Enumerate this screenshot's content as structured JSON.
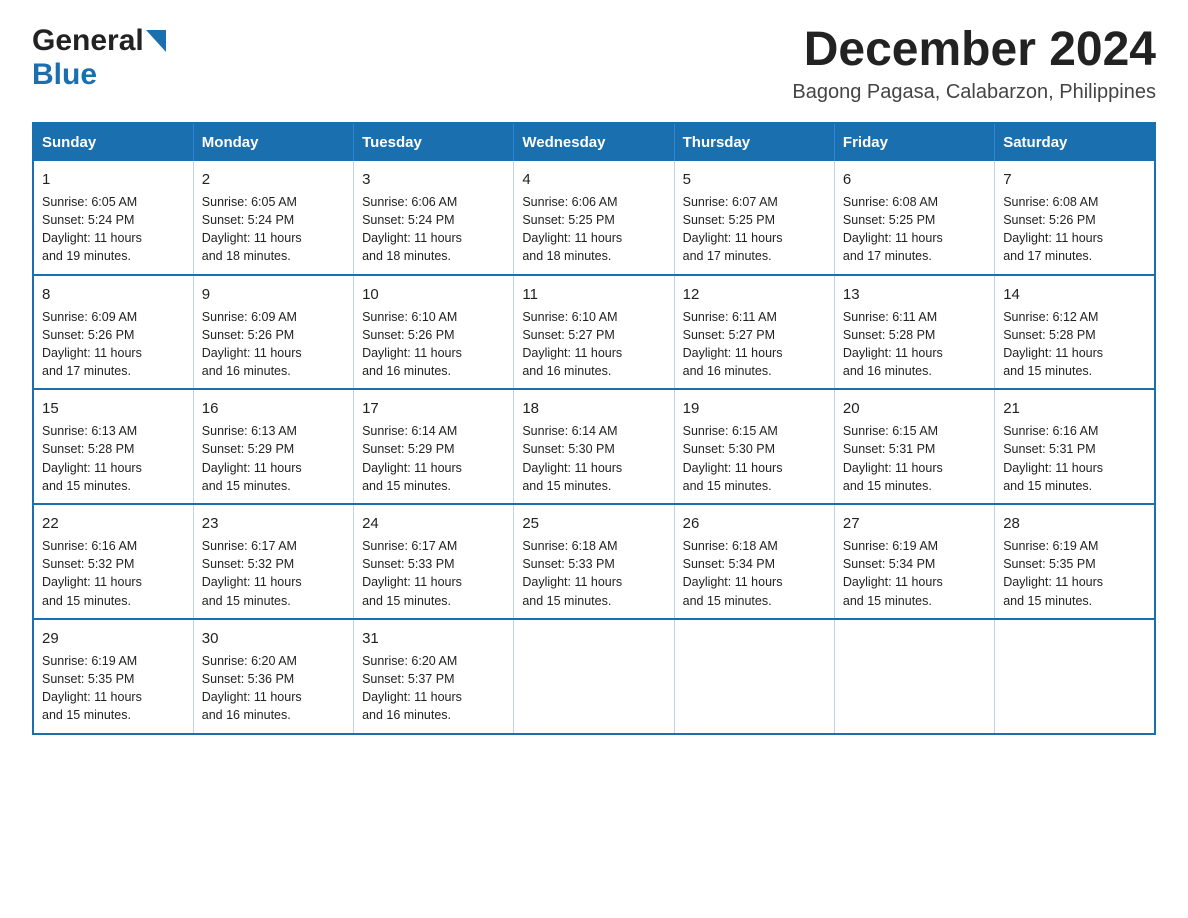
{
  "header": {
    "logo_general": "General",
    "logo_blue": "Blue",
    "month_year": "December 2024",
    "location": "Bagong Pagasa, Calabarzon, Philippines"
  },
  "calendar": {
    "days_of_week": [
      "Sunday",
      "Monday",
      "Tuesday",
      "Wednesday",
      "Thursday",
      "Friday",
      "Saturday"
    ],
    "weeks": [
      [
        {
          "day": "1",
          "sunrise": "6:05 AM",
          "sunset": "5:24 PM",
          "daylight": "11 hours and 19 minutes."
        },
        {
          "day": "2",
          "sunrise": "6:05 AM",
          "sunset": "5:24 PM",
          "daylight": "11 hours and 18 minutes."
        },
        {
          "day": "3",
          "sunrise": "6:06 AM",
          "sunset": "5:24 PM",
          "daylight": "11 hours and 18 minutes."
        },
        {
          "day": "4",
          "sunrise": "6:06 AM",
          "sunset": "5:25 PM",
          "daylight": "11 hours and 18 minutes."
        },
        {
          "day": "5",
          "sunrise": "6:07 AM",
          "sunset": "5:25 PM",
          "daylight": "11 hours and 17 minutes."
        },
        {
          "day": "6",
          "sunrise": "6:08 AM",
          "sunset": "5:25 PM",
          "daylight": "11 hours and 17 minutes."
        },
        {
          "day": "7",
          "sunrise": "6:08 AM",
          "sunset": "5:26 PM",
          "daylight": "11 hours and 17 minutes."
        }
      ],
      [
        {
          "day": "8",
          "sunrise": "6:09 AM",
          "sunset": "5:26 PM",
          "daylight": "11 hours and 17 minutes."
        },
        {
          "day": "9",
          "sunrise": "6:09 AM",
          "sunset": "5:26 PM",
          "daylight": "11 hours and 16 minutes."
        },
        {
          "day": "10",
          "sunrise": "6:10 AM",
          "sunset": "5:26 PM",
          "daylight": "11 hours and 16 minutes."
        },
        {
          "day": "11",
          "sunrise": "6:10 AM",
          "sunset": "5:27 PM",
          "daylight": "11 hours and 16 minutes."
        },
        {
          "day": "12",
          "sunrise": "6:11 AM",
          "sunset": "5:27 PM",
          "daylight": "11 hours and 16 minutes."
        },
        {
          "day": "13",
          "sunrise": "6:11 AM",
          "sunset": "5:28 PM",
          "daylight": "11 hours and 16 minutes."
        },
        {
          "day": "14",
          "sunrise": "6:12 AM",
          "sunset": "5:28 PM",
          "daylight": "11 hours and 15 minutes."
        }
      ],
      [
        {
          "day": "15",
          "sunrise": "6:13 AM",
          "sunset": "5:28 PM",
          "daylight": "11 hours and 15 minutes."
        },
        {
          "day": "16",
          "sunrise": "6:13 AM",
          "sunset": "5:29 PM",
          "daylight": "11 hours and 15 minutes."
        },
        {
          "day": "17",
          "sunrise": "6:14 AM",
          "sunset": "5:29 PM",
          "daylight": "11 hours and 15 minutes."
        },
        {
          "day": "18",
          "sunrise": "6:14 AM",
          "sunset": "5:30 PM",
          "daylight": "11 hours and 15 minutes."
        },
        {
          "day": "19",
          "sunrise": "6:15 AM",
          "sunset": "5:30 PM",
          "daylight": "11 hours and 15 minutes."
        },
        {
          "day": "20",
          "sunrise": "6:15 AM",
          "sunset": "5:31 PM",
          "daylight": "11 hours and 15 minutes."
        },
        {
          "day": "21",
          "sunrise": "6:16 AM",
          "sunset": "5:31 PM",
          "daylight": "11 hours and 15 minutes."
        }
      ],
      [
        {
          "day": "22",
          "sunrise": "6:16 AM",
          "sunset": "5:32 PM",
          "daylight": "11 hours and 15 minutes."
        },
        {
          "day": "23",
          "sunrise": "6:17 AM",
          "sunset": "5:32 PM",
          "daylight": "11 hours and 15 minutes."
        },
        {
          "day": "24",
          "sunrise": "6:17 AM",
          "sunset": "5:33 PM",
          "daylight": "11 hours and 15 minutes."
        },
        {
          "day": "25",
          "sunrise": "6:18 AM",
          "sunset": "5:33 PM",
          "daylight": "11 hours and 15 minutes."
        },
        {
          "day": "26",
          "sunrise": "6:18 AM",
          "sunset": "5:34 PM",
          "daylight": "11 hours and 15 minutes."
        },
        {
          "day": "27",
          "sunrise": "6:19 AM",
          "sunset": "5:34 PM",
          "daylight": "11 hours and 15 minutes."
        },
        {
          "day": "28",
          "sunrise": "6:19 AM",
          "sunset": "5:35 PM",
          "daylight": "11 hours and 15 minutes."
        }
      ],
      [
        {
          "day": "29",
          "sunrise": "6:19 AM",
          "sunset": "5:35 PM",
          "daylight": "11 hours and 15 minutes."
        },
        {
          "day": "30",
          "sunrise": "6:20 AM",
          "sunset": "5:36 PM",
          "daylight": "11 hours and 16 minutes."
        },
        {
          "day": "31",
          "sunrise": "6:20 AM",
          "sunset": "5:37 PM",
          "daylight": "11 hours and 16 minutes."
        },
        null,
        null,
        null,
        null
      ]
    ],
    "sunrise_label": "Sunrise:",
    "sunset_label": "Sunset:",
    "daylight_label": "Daylight:"
  }
}
